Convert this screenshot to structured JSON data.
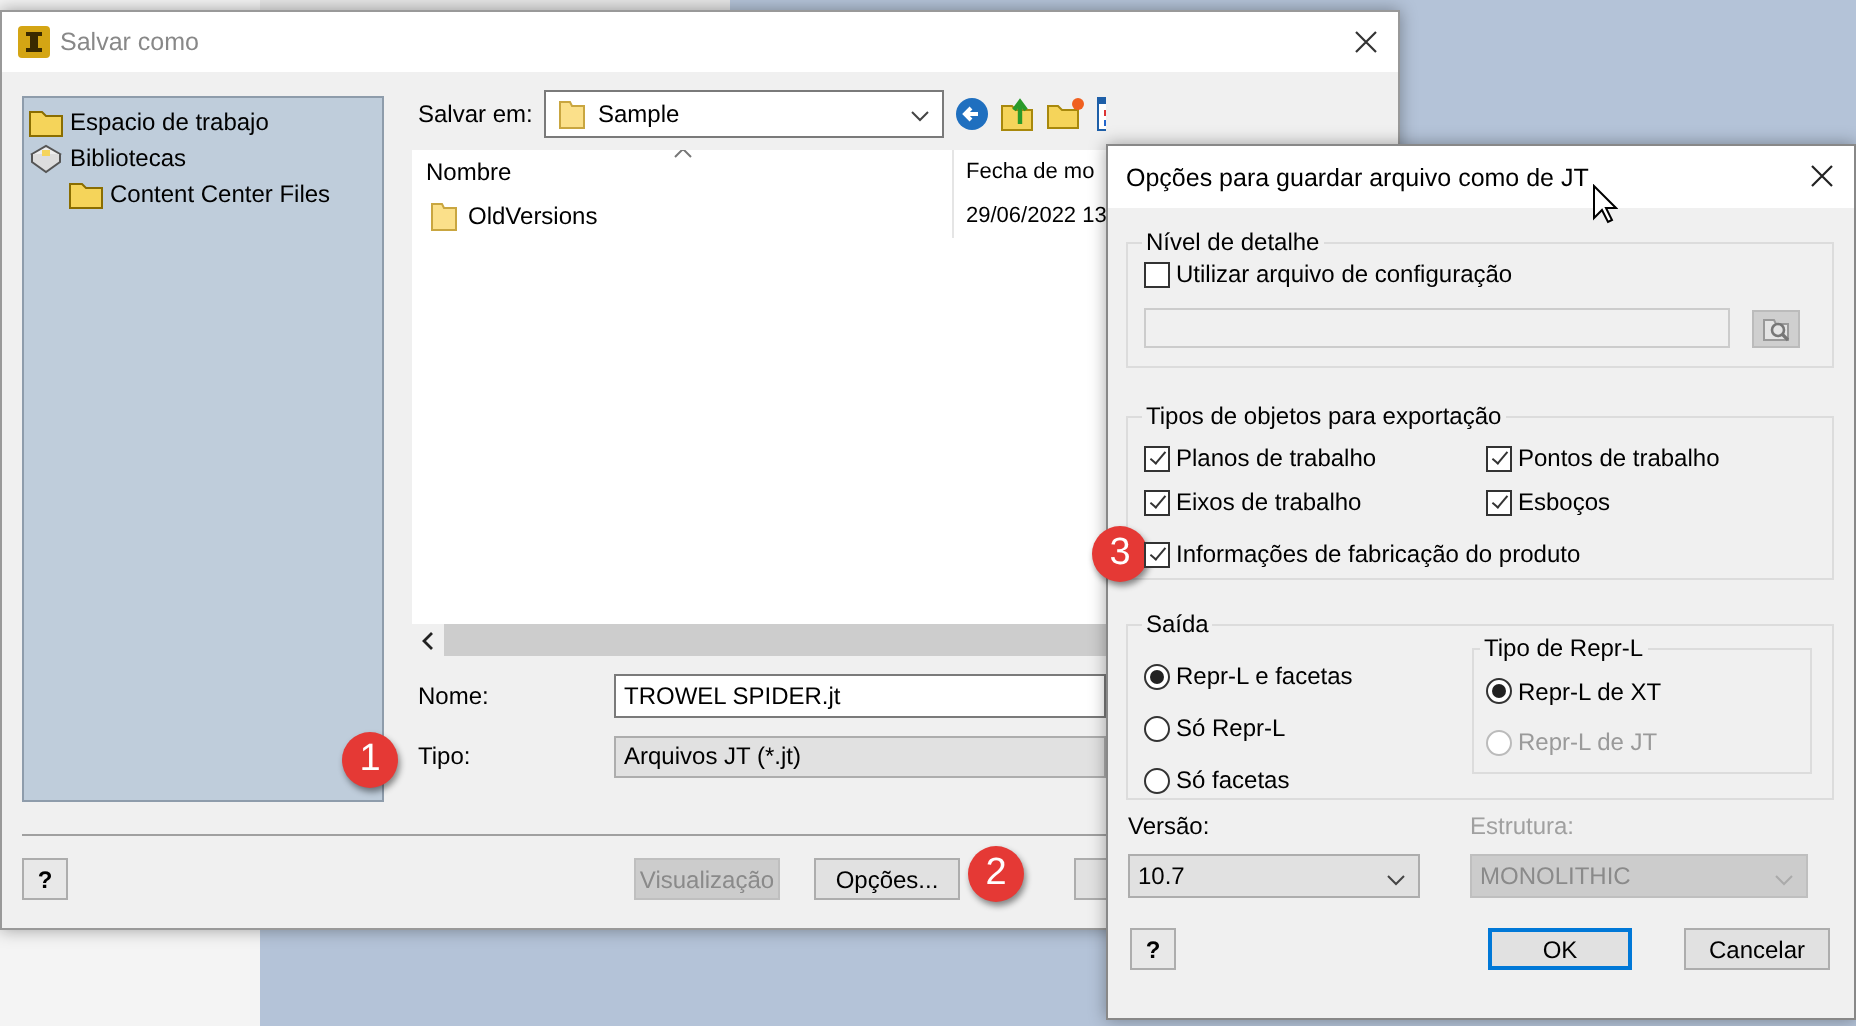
{
  "save_dialog": {
    "title": "Salvar como",
    "sidebar": {
      "items": [
        {
          "label": "Espacio de trabajo",
          "kind": "folder"
        },
        {
          "label": "Bibliotecas",
          "kind": "library",
          "children": [
            {
              "label": "Content Center Files",
              "kind": "folder"
            }
          ]
        }
      ]
    },
    "save_in": {
      "label": "Salvar em:",
      "value": "Sample"
    },
    "file_list": {
      "columns": [
        {
          "label": "Nombre",
          "sorted": true
        },
        {
          "label": "Fecha de mo",
          "sorted": false
        }
      ],
      "rows": [
        {
          "name": "OldVersions",
          "date": "29/06/2022 13",
          "selected": false
        }
      ]
    },
    "name_field": {
      "label": "Nome:",
      "value": "TROWEL SPIDER.jt"
    },
    "type_field": {
      "label": "Tipo:",
      "value": "Arquivos JT (*.jt)",
      "callout": "1"
    },
    "help_label": "?",
    "buttons": [
      {
        "label": "Visualização",
        "disabled": true
      },
      {
        "label": "Opções...",
        "disabled": false,
        "callout": "2"
      },
      {
        "disabled": false
      }
    ]
  },
  "options_dialog": {
    "title": "Opções para guardar arquivo como de JT",
    "detail_group": {
      "title": "Nível de detalhe",
      "checkbox": {
        "label": "Utilizar arquivo de configuração",
        "checked": false
      }
    },
    "objects_group": {
      "title": "Tipos de objetos para exportação",
      "checkboxes": [
        {
          "label": "Planos de trabalho",
          "checked": true
        },
        {
          "label": "Pontos de trabalho",
          "checked": true
        },
        {
          "label": "Eixos de trabalho",
          "checked": true
        },
        {
          "label": "Esboços",
          "checked": true
        },
        {
          "label": "Informações de fabricação do produto",
          "checked": true,
          "callout": "3"
        }
      ]
    },
    "output_group": {
      "title": "Saída",
      "options": [
        {
          "label": "Repr-L e facetas",
          "selected": true
        },
        {
          "label": "Só Repr-L",
          "selected": false
        },
        {
          "label": "Só facetas",
          "selected": false
        }
      ],
      "subgroup": {
        "title": "Tipo de Repr-L",
        "options": [
          {
            "label": "Repr-L de XT",
            "selected": true,
            "disabled": false
          },
          {
            "label": "Repr-L de JT",
            "selected": false,
            "disabled": true
          }
        ]
      }
    },
    "version": {
      "label": "Versão:",
      "value": "10.7",
      "disabled": false
    },
    "structure": {
      "label": "Estrutura:",
      "value": "MONOLITHIC",
      "disabled": true
    },
    "help_label": "?",
    "buttons": [
      {
        "label": "OK",
        "default": true
      },
      {
        "label": "Cancelar",
        "default": false
      }
    ]
  }
}
